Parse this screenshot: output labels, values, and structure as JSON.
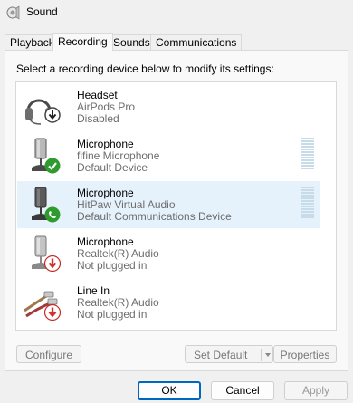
{
  "window": {
    "title": "Sound",
    "icon": "speaker-icon"
  },
  "tabs": [
    {
      "label": "Playback"
    },
    {
      "label": "Recording",
      "active": true
    },
    {
      "label": "Sounds"
    },
    {
      "label": "Communications"
    }
  ],
  "instruction": "Select a recording device below to modify its settings:",
  "devices": [
    {
      "name": "Headset",
      "description": "AirPods Pro",
      "status": "Disabled",
      "icon": "headset-icon",
      "badge": "down-arrow-badge-icon"
    },
    {
      "name": "Microphone",
      "description": "fifine Microphone",
      "status": "Default Device",
      "icon": "microphone-icon",
      "badge": "green-check-badge-icon"
    },
    {
      "name": "Microphone",
      "description": "HitPaw Virtual Audio",
      "status": "Default Communications Device",
      "icon": "microphone-icon",
      "badge": "green-phone-badge-icon",
      "selected": true
    },
    {
      "name": "Microphone",
      "description": "Realtek(R) Audio",
      "status": "Not plugged in",
      "icon": "microphone-icon",
      "badge": "red-down-arrow-badge-icon"
    },
    {
      "name": "Line In",
      "description": "Realtek(R) Audio",
      "status": "Not plugged in",
      "icon": "line-in-cable-icon",
      "badge": "red-down-arrow-badge-icon"
    }
  ],
  "buttons": {
    "configure": "Configure",
    "set_default": "Set Default",
    "properties": "Properties",
    "ok": "OK",
    "cancel": "Cancel",
    "apply": "Apply"
  },
  "colors": {
    "selection": "#e5f1fb",
    "default_button_border": "#0067c0",
    "check_badge": "#2e9b2e",
    "down_badge": "#d32f2f",
    "meter": "#c8dbe8"
  }
}
